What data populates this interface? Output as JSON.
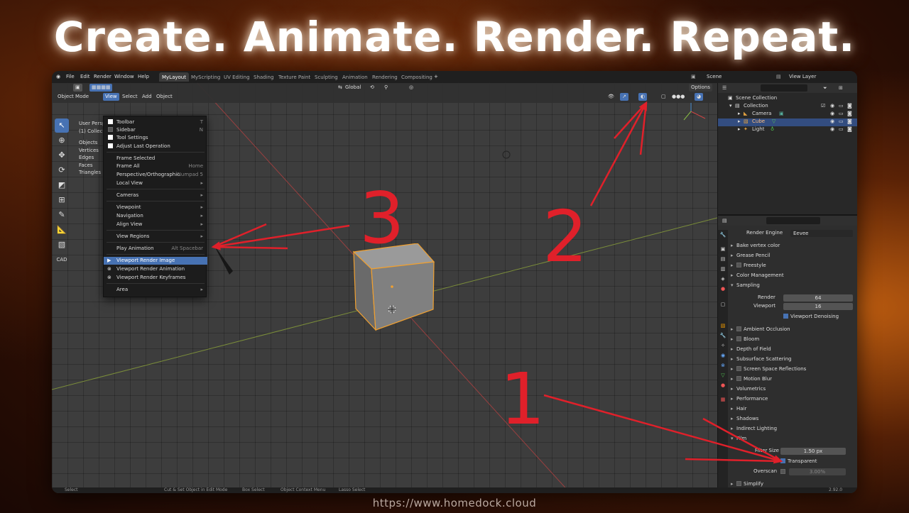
{
  "headline": "Create. Animate. Render. Repeat.",
  "footer_url": "https://www.homedock.cloud",
  "menu": [
    "File",
    "Edit",
    "Render",
    "Window",
    "Help"
  ],
  "workspaces": [
    "MyLayout",
    "MyScripting",
    "UV Editing",
    "Shading",
    "Texture Paint",
    "Sculpting",
    "Animation",
    "Rendering",
    "Compositing"
  ],
  "scene": "Scene",
  "view_layer": "View Layer",
  "header": {
    "mode": "Object Mode",
    "view": "View",
    "select": "Select",
    "add": "Add",
    "object": "Object",
    "orientation": "Global",
    "options": "Options"
  },
  "stats": {
    "title1": "User Perspe",
    "title2": "(1) Collecti",
    "objects": "Objects",
    "vertices": "Vertices",
    "edges": "Edges",
    "faces": "Faces",
    "triangles": "Triangles"
  },
  "view_menu": {
    "toolbar": "Toolbar",
    "toolbar_sc": "T",
    "sidebar": "Sidebar",
    "sidebar_sc": "N",
    "tool_settings": "Tool Settings",
    "adjust_last": "Adjust Last Operation",
    "frame_selected": "Frame Selected",
    "frame_all": "Frame All",
    "frame_all_sc": "Home",
    "persp": "Perspective/Orthographic",
    "persp_sc": "Numpad 5",
    "local_view": "Local View",
    "cameras": "Cameras",
    "viewpoint": "Viewpoint",
    "navigation": "Navigation",
    "align_view": "Align View",
    "view_regions": "View Regions",
    "play_animation": "Play Animation",
    "play_sc": "Alt Spacebar",
    "render_image": "Viewport Render Image",
    "render_animation": "Viewport Render Animation",
    "render_keyframes": "Viewport Render Keyframes",
    "area": "Area"
  },
  "outliner": {
    "scene_collection": "Scene Collection",
    "collection": "Collection",
    "camera": "Camera",
    "cube": "Cube",
    "light": "Light"
  },
  "properties": {
    "render_engine_label": "Render Engine",
    "render_engine": "Eevee",
    "bake": "Bake vertex color",
    "grease_pencil": "Grease Pencil",
    "freestyle": "Freestyle",
    "color_mgmt": "Color Management",
    "sampling": "Sampling",
    "render_label": "Render",
    "render_val": "64",
    "viewport_label": "Viewport",
    "viewport_val": "16",
    "denoise": "Viewport Denoising",
    "ao": "Ambient Occlusion",
    "bloom": "Bloom",
    "dof": "Depth of Field",
    "sss": "Subsurface Scattering",
    "ssr": "Screen Space Reflections",
    "motion_blur": "Motion Blur",
    "volumetrics": "Volumetrics",
    "performance": "Performance",
    "hair": "Hair",
    "shadows": "Shadows",
    "indirect": "Indirect Lighting",
    "film": "Film",
    "filter_label": "Filter Size",
    "filter_val": "1.50 px",
    "transparent": "Transparent",
    "overscan_label": "Overscan",
    "overscan_val": "3.00%",
    "simplify": "Simplify"
  },
  "status": {
    "select": "Select",
    "cut": "Cut & Set Object in Edit Mode",
    "box": "Box Select",
    "ctx": "Object Context Menu",
    "lasso": "Lasso Select",
    "version": "2.92.0"
  },
  "annotations": [
    "1",
    "2",
    "3"
  ],
  "colors": {
    "annotation": "#e0202a",
    "accent": "#4772b3",
    "selection_outline": "#f0a030"
  }
}
